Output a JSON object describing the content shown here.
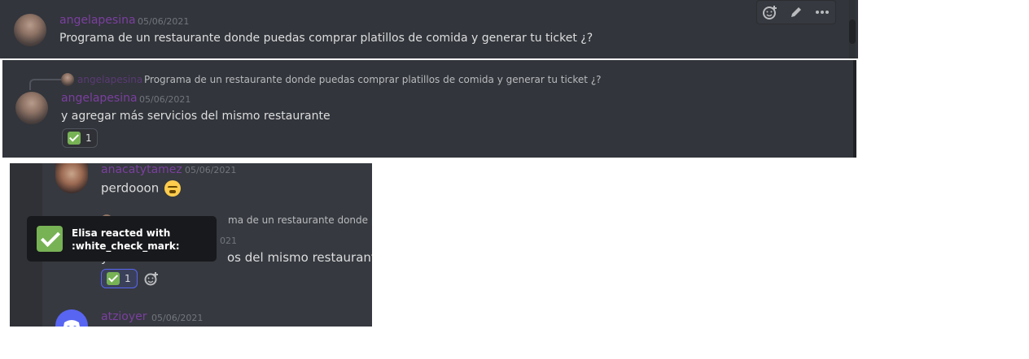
{
  "panel1": {
    "username": "angelapesina",
    "date": "05/06/2021",
    "message": "Programa de un restaurante donde puedas comprar platillos de comida y generar tu ticket ¿?"
  },
  "toolbar": {
    "icons": [
      "add-reaction-icon",
      "edit-icon",
      "more-options-icon"
    ]
  },
  "panel2": {
    "reply": {
      "username": "angelapesina",
      "text": "Programa de un restaurante donde puedas comprar platillos de comida y generar tu ticket ¿?"
    },
    "username": "angelapesina",
    "date": "05/06/2021",
    "message": "y agregar más servicios del mismo restaurante",
    "reaction": {
      "emoji": "white-check-mark",
      "count": "1"
    }
  },
  "panel3": {
    "msg1": {
      "username": "anacatytamez",
      "date": "05/06/2021",
      "message": "perdooon",
      "emoji": "weary-face"
    },
    "reply_partial": "ma de un restaurante donde pued",
    "date_partial": "021",
    "message_partial": "os del mismo restaurante",
    "reaction": {
      "emoji": "white-check-mark",
      "count": "1"
    },
    "msg3": {
      "username": "atzioyer",
      "date": "05/06/2021"
    },
    "tooltip": {
      "line1": "Elisa reacted with",
      "line2": ":white_check_mark:"
    }
  },
  "colors": {
    "username": "#7b3fa0",
    "background": "#36393f",
    "check": "#77b255",
    "discord": "#5865f2"
  }
}
